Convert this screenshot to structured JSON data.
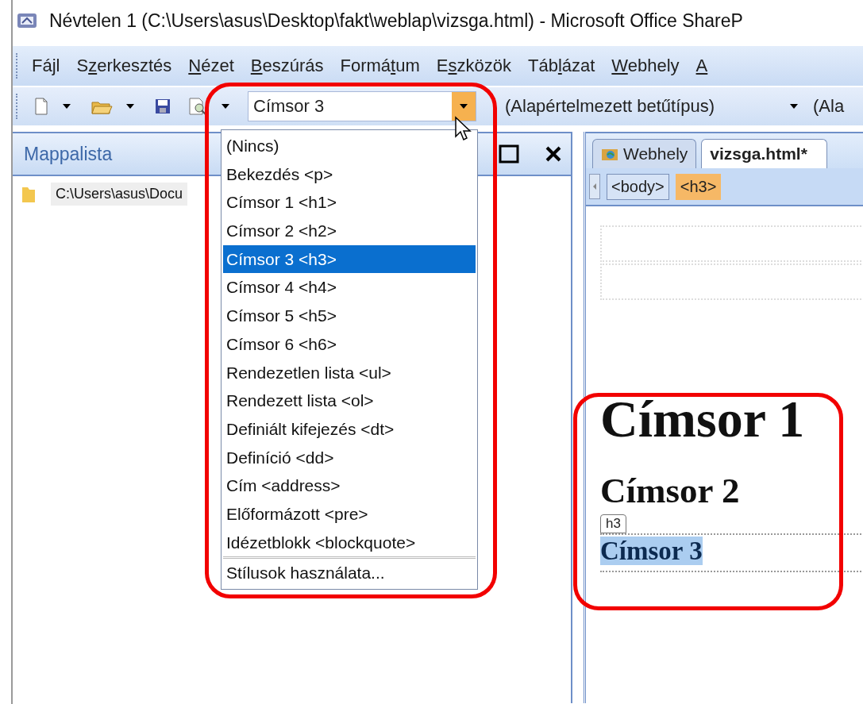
{
  "title_bar": {
    "title": "Névtelen 1 (C:\\Users\\asus\\Desktop\\fakt\\weblap\\vizsga.html) - Microsoft Office ShareP"
  },
  "menu_bar": [
    {
      "before": "Fá",
      "key": "j",
      "after": "l"
    },
    {
      "before": "S",
      "key": "z",
      "after": "erkesztés"
    },
    {
      "key": "N",
      "after": "ézet"
    },
    {
      "key": "B",
      "after": "eszúrás"
    },
    {
      "before": "Formá",
      "key": "t",
      "after": "um"
    },
    {
      "before": "E",
      "key": "s",
      "after": "zközök"
    },
    {
      "before": "Táb",
      "key": "l",
      "after": "ázat"
    },
    {
      "key": "W",
      "after": "ebhely"
    },
    {
      "key": "A"
    }
  ],
  "toolbar": {
    "style_box": {
      "value": "Címsor 3",
      "open": true
    },
    "font_box": {
      "value": "(Alapértelmezett betűtípus)"
    },
    "size_box": {
      "value": "(Ala"
    }
  },
  "style_dropdown": {
    "items": [
      {
        "label": "(Nincs)",
        "selected": false
      },
      {
        "label": "Bekezdés <p>",
        "selected": false
      },
      {
        "label": "Címsor 1 <h1>",
        "selected": false
      },
      {
        "label": "Címsor 2 <h2>",
        "selected": false
      },
      {
        "label": "Címsor 3 <h3>",
        "selected": true
      },
      {
        "label": "Címsor 4 <h4>",
        "selected": false
      },
      {
        "label": "Címsor 5 <h5>",
        "selected": false
      },
      {
        "label": "Címsor 6 <h6>",
        "selected": false
      },
      {
        "label": "Rendezetlen lista <ul>",
        "selected": false
      },
      {
        "label": "Rendezett lista <ol>",
        "selected": false
      },
      {
        "label": "Definiált kifejezés <dt>",
        "selected": false
      },
      {
        "label": "Definíció <dd>",
        "selected": false
      },
      {
        "label": "Cím <address>",
        "selected": false
      },
      {
        "label": "Előformázott <pre>",
        "selected": false
      },
      {
        "label": "Idézetblokk <blockquote>",
        "selected": false
      }
    ],
    "footer": "Stílusok használata..."
  },
  "folder_panel": {
    "title": "Mappalista",
    "items": [
      {
        "label": "C:\\Users\\asus\\Docu"
      }
    ]
  },
  "editor": {
    "tabs": [
      {
        "label": "Webhely",
        "selected": false,
        "kind": "site"
      },
      {
        "label": "vizsga.html*",
        "selected": true,
        "kind": "file"
      }
    ],
    "breadcrumb": [
      {
        "label": "<body>",
        "selected": false
      },
      {
        "label": "<h3>",
        "selected": true
      }
    ],
    "content": [
      {
        "kind": "h1",
        "text": "Címsor 1",
        "selected": false
      },
      {
        "kind": "h2",
        "text": "Címsor 2",
        "selected": false
      },
      {
        "kind": "h3",
        "text": "Címsor 3",
        "tag": "h3",
        "selected": true
      }
    ]
  }
}
